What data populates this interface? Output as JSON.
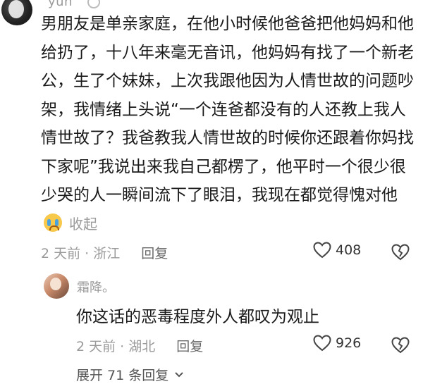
{
  "comment": {
    "username": "yun",
    "text": "男朋友是单亲家庭，在他小时候他爸爸把他妈妈和他给扔了，十八年来毫无音讯，他妈妈有找了一个新老公，生了个妹妹，上次我跟他因为人情世故的问题吵架，我情绪上头说“一个连爸都没有的人还教上我人情世故了？我爸教我人情世故的时候你还跟着你妈找下家呢”我说出来我自己都楞了，他平时一个很少很少哭的人一瞬间流下了眼泪，我现在都觉得愧对他",
    "emoji": "crying-face",
    "collapse_label": "收起",
    "time_location": "2 天前 · 浙江",
    "reply_label": "回复",
    "likes": "408"
  },
  "reply": {
    "username": "霜降。",
    "text": "你这话的恶毒程度外人都叹为观止",
    "time_location": "2 天前 · 湖北",
    "reply_label": "回复",
    "likes": "926"
  },
  "expand_label": "展开 71 条回复",
  "icons": {
    "like": "heart-outline-icon",
    "dislike": "broken-heart-icon",
    "expand": "chevron-down-icon"
  }
}
